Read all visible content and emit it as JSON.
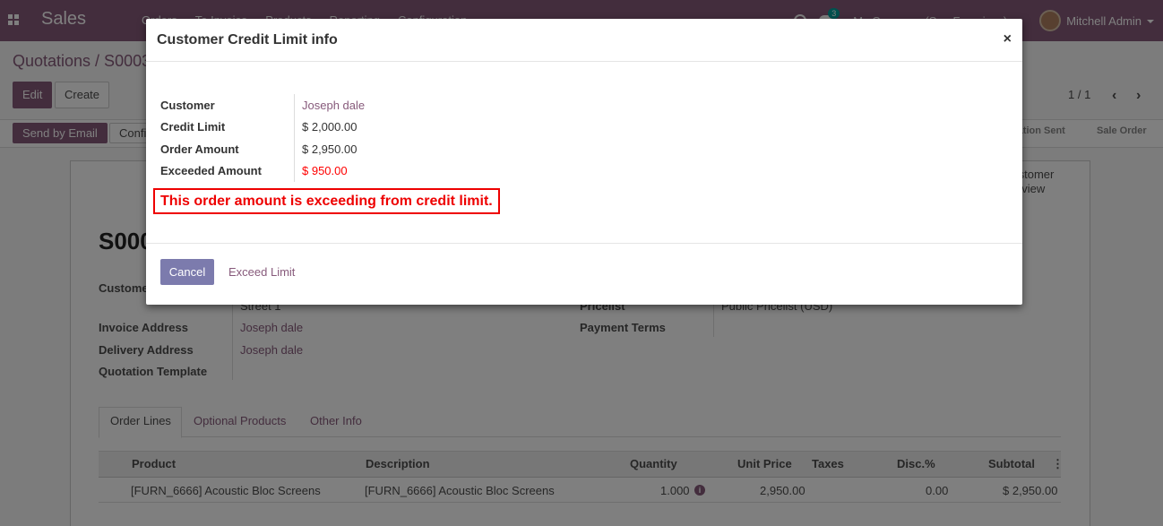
{
  "navbar": {
    "app_name": "Sales",
    "menu": [
      "Orders",
      "To Invoice",
      "Products",
      "Reporting",
      "Configuration"
    ],
    "chat_count": "3",
    "company": "My Company (San Francisco)",
    "user": "Mitchell Admin"
  },
  "control": {
    "breadcrumb": "Quotations / S0003",
    "edit_label": "Edit",
    "create_label": "Create",
    "pager": "1 / 1",
    "send_email_label": "Send by Email",
    "confirm_label": "Confirm",
    "stages": [
      "Quotation Sent",
      "Sale Order"
    ]
  },
  "sheet": {
    "customer_preview": "Customer Preview",
    "title": "S0003",
    "fields": {
      "customer_label": "Customer",
      "customer_street": "Street 1",
      "invoice_label": "Invoice Address",
      "invoice_value": "Joseph dale",
      "delivery_label": "Delivery Address",
      "delivery_value": "Joseph dale",
      "template_label": "Quotation Template",
      "pricelist_label": "Pricelist",
      "pricelist_value": "Public Pricelist (USD)",
      "payment_terms_label": "Payment Terms"
    },
    "tabs": [
      "Order Lines",
      "Optional Products",
      "Other Info"
    ],
    "table": {
      "headers": [
        "Product",
        "Description",
        "Quantity",
        "Unit Price",
        "Taxes",
        "Disc.%",
        "Subtotal"
      ],
      "rows": [
        {
          "product": "[FURN_6666] Acoustic Bloc Screens",
          "description": "[FURN_6666] Acoustic Bloc Screens",
          "quantity": "1.000",
          "unit_price": "2,950.00",
          "taxes": "",
          "discount": "0.00",
          "subtotal": "$ 2,950.00"
        }
      ]
    }
  },
  "modal": {
    "title": "Customer Credit Limit info",
    "close": "×",
    "customer_label": "Customer",
    "customer_value": "Joseph dale",
    "credit_limit_label": "Credit Limit",
    "credit_limit_value": "$ 2,000.00",
    "order_amount_label": "Order Amount",
    "order_amount_value": "$ 2,950.00",
    "exceeded_label": "Exceeded Amount",
    "exceeded_value": "$ 950.00",
    "warning": "This order amount is exceeding from credit limit.",
    "cancel_label": "Cancel",
    "exceed_label": "Exceed Limit"
  },
  "colors": {
    "brand": "#875a7b",
    "warning": "#ff0000",
    "cancel_button": "#7c7bad"
  }
}
